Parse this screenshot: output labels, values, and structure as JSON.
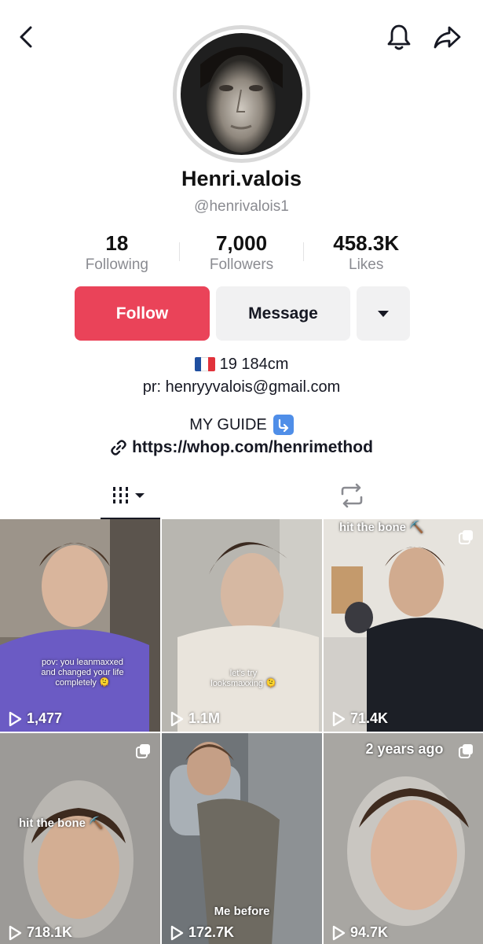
{
  "header": {
    "back_icon": "chevron-left-icon",
    "bell_icon": "bell-icon",
    "share_icon": "share-arrow-icon"
  },
  "profile": {
    "display_name": "Henri.valois",
    "username": "@henrivalois1"
  },
  "stats": [
    {
      "value": "18",
      "label": "Following"
    },
    {
      "value": "7,000",
      "label": "Followers"
    },
    {
      "value": "458.3K",
      "label": "Likes"
    }
  ],
  "actions": {
    "follow_label": "Follow",
    "message_label": "Message",
    "more_icon": "caret-down-icon"
  },
  "bio": {
    "line1": "19 184cm",
    "line2": "pr: henryyvalois@gmail.com",
    "guide": "MY GUIDE",
    "link": "https://whop.com/henrimethod"
  },
  "tabs": [
    {
      "name": "videos",
      "icon": "grid-bars-icon",
      "active": true
    },
    {
      "name": "reposts",
      "icon": "repost-icon",
      "active": false
    }
  ],
  "videos": [
    {
      "views": "1,477",
      "caption": "pov: you leanmaxxed and changed your life completely 🫠",
      "multi": false
    },
    {
      "views": "1.1M",
      "caption": "let's try looksmaxxing 🫠",
      "multi": false
    },
    {
      "views": "71.4K",
      "caption": "hit the bone ⛏️",
      "multi": true
    },
    {
      "views": "718.1K",
      "caption": "hit the bone ⛏️",
      "multi": true
    },
    {
      "views": "172.7K",
      "caption": "Me before",
      "multi": false
    },
    {
      "views": "94.7K",
      "caption": "2 years ago",
      "multi": true
    }
  ],
  "colors": {
    "follow": "#ea4359",
    "secondary_btn": "#f1f1f2",
    "muted_text": "#8a8b91"
  }
}
